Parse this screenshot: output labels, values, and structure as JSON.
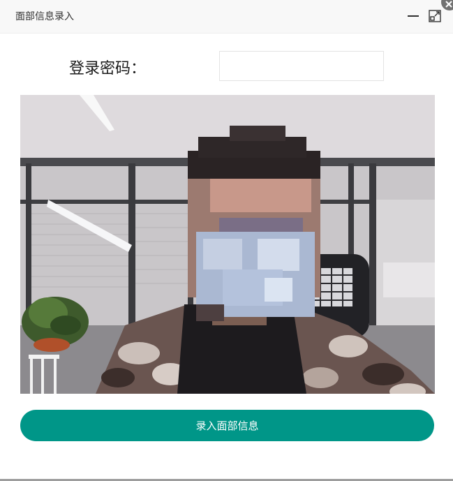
{
  "dialog": {
    "title": "面部信息录入",
    "controls": {
      "minimize": "minimize-icon",
      "maximize": "maximize-icon",
      "close": "close-icon"
    }
  },
  "form": {
    "password_label": "登录密码：",
    "password_value": "",
    "password_placeholder": ""
  },
  "camera": {
    "preview": "webcam-preview"
  },
  "actions": {
    "submit_label": "录入面部信息"
  },
  "colors": {
    "accent": "#009688",
    "titlebar_bg": "#f8f8f8",
    "close_bg": "#727272"
  }
}
